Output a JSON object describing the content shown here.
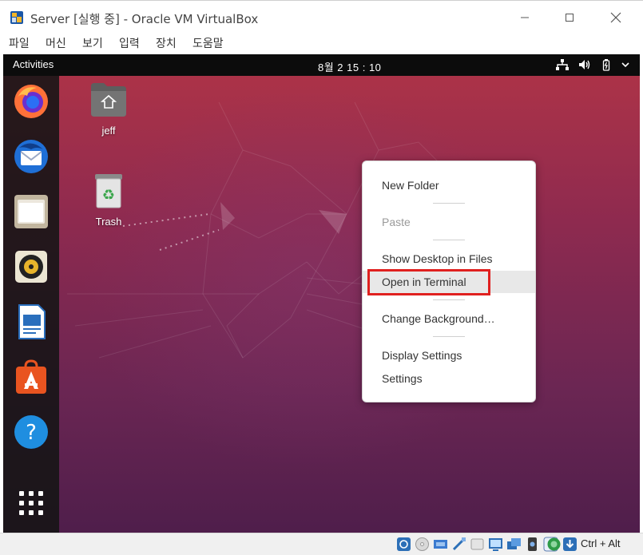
{
  "window": {
    "title": "Server [실행 중] - Oracle VM VirtualBox",
    "controls": {
      "minimize": "–",
      "maximize": "☐",
      "close": "✕"
    }
  },
  "menu": [
    "파일",
    "머신",
    "보기",
    "입력",
    "장치",
    "도움말"
  ],
  "guest": {
    "topbar": {
      "activities": "Activities",
      "clock": "8월 2  15 : 10",
      "tray_icons": [
        "network-icon",
        "volume-icon",
        "battery-icon",
        "power-menu-icon"
      ]
    },
    "dock": [
      "firefox-icon",
      "thunderbird-icon",
      "files-icon",
      "rhythmbox-icon",
      "libreoffice-writer-icon",
      "software-center-icon",
      "help-icon",
      "show-applications-icon"
    ],
    "desktop_icons": [
      {
        "label": "jeff",
        "icon": "home-folder-icon"
      },
      {
        "label": "Trash",
        "icon": "trash-icon"
      }
    ],
    "context_menu": {
      "items": [
        "New Folder",
        "Paste",
        "Show Desktop in Files",
        "Open in Terminal",
        "Change Background…",
        "Display Settings",
        "Settings"
      ],
      "disabled": [
        "Paste"
      ],
      "hovered": "Open in Terminal"
    },
    "highlight_color": "#e0201f"
  },
  "statusbar": {
    "host_key": "Ctrl + Alt",
    "icons": [
      "hard-disk-icon",
      "optical-drive-icon",
      "audio-icon",
      "network-adapter-icon",
      "usb-icon",
      "shared-folders-icon",
      "display-icon",
      "video-capture-icon",
      "recording-icon",
      "cpu-icon",
      "mouse-integration-icon",
      "host-key-arrow-icon"
    ]
  },
  "colors": {
    "wallpaper_top": "#b03447",
    "wallpaper_bottom": "#4f1e4b",
    "topbar": "#0c0c0c",
    "dock": "#141414"
  }
}
